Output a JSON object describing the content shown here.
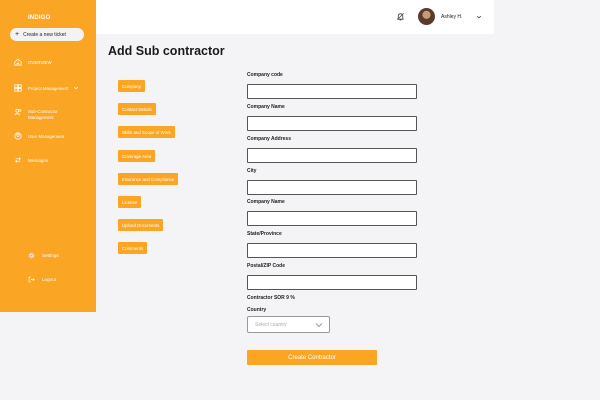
{
  "brand": {
    "name": "INDIGO"
  },
  "sidebar": {
    "new_ticket_label": "Create a new ticket",
    "items": [
      {
        "label": "OVERVIEW"
      },
      {
        "label": "Project Management"
      },
      {
        "label": "Sub-Contractor Management"
      },
      {
        "label": "User Management"
      },
      {
        "label": "Messages"
      }
    ],
    "bottom": [
      {
        "label": "Settings"
      },
      {
        "label": "Logout"
      }
    ]
  },
  "header": {
    "username": "Ashley H."
  },
  "page": {
    "title": "Add Sub contractor"
  },
  "sections": [
    "Company",
    "Contact Details",
    "Skills and Scope of Work",
    "Coverage Area",
    "Insurance and Compliance",
    "License",
    "Upload Documents",
    "Comments"
  ],
  "form": {
    "fields": [
      {
        "label": "Company code",
        "value": ""
      },
      {
        "label": "Company Name",
        "value": ""
      },
      {
        "label": "Company Address",
        "value": ""
      },
      {
        "label": "City",
        "value": ""
      },
      {
        "label": "Company Name",
        "value": ""
      },
      {
        "label": "State/Province",
        "value": ""
      },
      {
        "label": "Postal/ZIP Code",
        "value": ""
      }
    ],
    "sor_label": "Contractor SOR 9 %",
    "country_label": "Country",
    "country_placeholder": "Select country",
    "submit_label": "Create Contractor"
  },
  "colors": {
    "accent": "#fba524",
    "background": "#f4f4f6"
  }
}
